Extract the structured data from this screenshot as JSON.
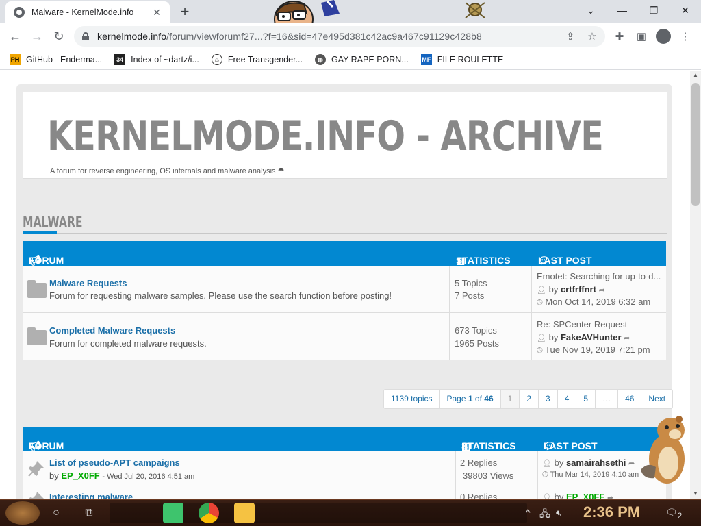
{
  "browser": {
    "tab_title": "Malware - KernelMode.info",
    "url_host": "kernelmode.info",
    "url_path": "/forum/viewforumf27",
    "url_hidden": "...",
    "url_query": "?f=16&sid=47e495d381c42ac9a467c91129c428b8",
    "bookmarks": [
      {
        "label": "GitHub - Enderma...",
        "icon": "PH"
      },
      {
        "label": "Index of ~dartz/i...",
        "icon": "34"
      },
      {
        "label": "Free Transgender...",
        "icon": "face-icon"
      },
      {
        "label": "GAY RAPE PORN...",
        "icon": "globe-icon"
      },
      {
        "label": "FILE ROULETTE",
        "icon": "MF"
      }
    ]
  },
  "site": {
    "title": "KERNELMODE.INFO - ARCHIVE",
    "description": "A forum for reverse engineering, OS internals and malware analysis",
    "section": "MALWARE"
  },
  "table1": {
    "headers": {
      "forum": "FORUM",
      "stats": "STATISTICS",
      "lastpost": "LAST POST"
    },
    "rows": [
      {
        "title": "Malware Requests",
        "desc": "Forum for requesting malware samples. Please use the search function before posting!",
        "stat1": "5 Topics",
        "stat2": "7 Posts",
        "lp_title": "Emotet: Searching for up-to-d...",
        "lp_by": "by",
        "lp_user": "crtfrffnrt",
        "lp_date": "Mon Oct 14, 2019 6:32 am"
      },
      {
        "title": "Completed Malware Requests",
        "desc": "Forum for completed malware requests.",
        "stat1": "673 Topics",
        "stat2": "1965 Posts",
        "lp_title": "Re: SPCenter Request",
        "lp_by": "by",
        "lp_user": "FakeAVHunter",
        "lp_date": "Tue Nov 19, 2019 7:21 pm"
      }
    ]
  },
  "pagination": {
    "topics": "1139 topics",
    "page_prefix": "Page",
    "page_cur": "1",
    "page_of": "of",
    "page_total": "46",
    "pages": [
      "1",
      "2",
      "3",
      "4",
      "5",
      "…",
      "46"
    ],
    "next": "Next"
  },
  "table2": {
    "headers": {
      "forum": "FORUM",
      "stats": "STATISTICS",
      "lastpost": "LAST POST"
    },
    "rows": [
      {
        "title": "List of pseudo-APT campaigns",
        "by": "by",
        "author": "EP_X0FF",
        "date": "- Wed Jul 20, 2016 4:51 am",
        "stat1": "2 Replies",
        "stat2": "39803 Views",
        "lp_by": "by",
        "lp_user": "samairahsethi",
        "lp_date": "Thu Mar 14, 2019 4:10 am"
      },
      {
        "title": "Interesting malware",
        "stat1": "0 Replies",
        "lp_by": "by",
        "lp_user": "EP_X0FF"
      }
    ]
  },
  "taskbar": {
    "clock": "2:36 PM",
    "notifications": "2"
  },
  "colors": {
    "header_blue": "#0288d1",
    "link_blue": "#1b6fa8",
    "author_green": "#00aa00",
    "title_gray": "#888888"
  }
}
